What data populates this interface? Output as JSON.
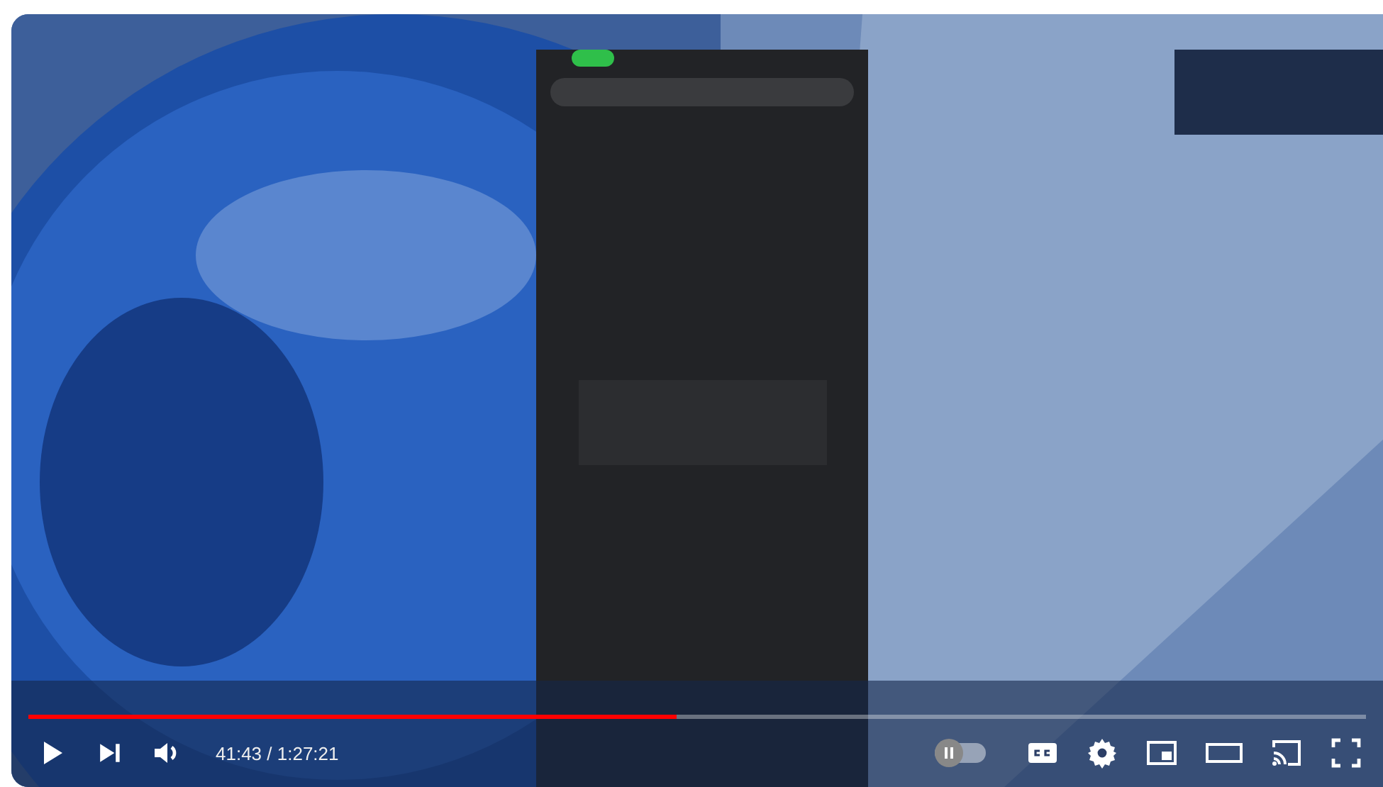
{
  "progress": {
    "level": 0.485
  },
  "time": {
    "current": "41:43",
    "separator": "/",
    "duration": "1:27:21"
  },
  "autoplay": {
    "on": false
  }
}
